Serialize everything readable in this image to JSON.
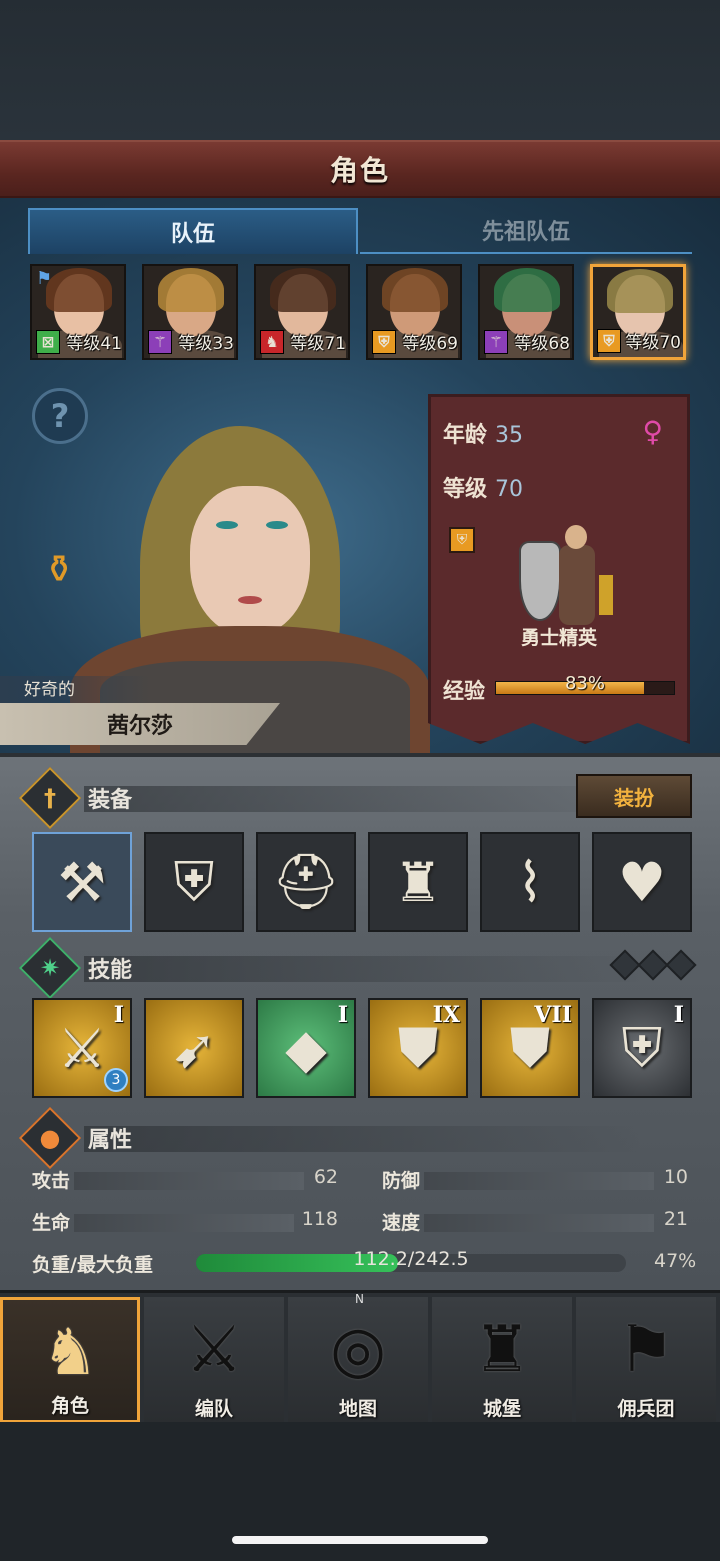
{
  "title": "角色",
  "tabs": {
    "team": "队伍",
    "ancestor_team": "先祖队伍"
  },
  "roster": [
    {
      "level_text": "等级41",
      "class_icon": "crossed-sword-icon",
      "badge_color": "#3fae4a",
      "badge_glyph": "⊠",
      "hair": "#6b3a1e",
      "skin": "#e8c0a4",
      "has_flag": true
    },
    {
      "level_text": "等级33",
      "class_icon": "staff-icon",
      "badge_color": "#8c3fb8",
      "badge_glyph": "⚚",
      "hair": "#b78a3a",
      "skin": "#d9a886",
      "has_flag": false
    },
    {
      "level_text": "等级71",
      "class_icon": "horse-icon",
      "badge_color": "#c8262a",
      "badge_glyph": "♞",
      "hair": "#4a2c1c",
      "skin": "#e2b89c",
      "has_flag": false
    },
    {
      "level_text": "等级69",
      "class_icon": "shield-icon",
      "badge_color": "#e89a22",
      "badge_glyph": "⛨",
      "hair": "#7a4a26",
      "skin": "#cf9a78",
      "has_flag": false
    },
    {
      "level_text": "等级68",
      "class_icon": "staff-icon",
      "badge_color": "#8c3fb8",
      "badge_glyph": "⚚",
      "hair": "#2f7a4a",
      "skin": "#c99078",
      "has_flag": false
    },
    {
      "level_text": "等级70",
      "class_icon": "shield-icon",
      "badge_color": "#e89a22",
      "badge_glyph": "⛨",
      "hair": "#9a8a4a",
      "skin": "#e6c4ae",
      "has_flag": false
    }
  ],
  "character": {
    "trait": "好奇的",
    "name": "茜尔莎",
    "age_label": "年龄",
    "age": "35",
    "level_label": "等级",
    "level": "70",
    "unit_class": "勇士精英",
    "exp_label": "经验",
    "exp_text": "83%",
    "exp_fraction": 0.83
  },
  "equipment": {
    "title": "装备",
    "dress_button": "装扮",
    "slots": [
      {
        "name": "warhammer-icon",
        "glyph": "⚒"
      },
      {
        "name": "shield-icon",
        "glyph": "⛨"
      },
      {
        "name": "helmet-icon",
        "glyph": "⛑"
      },
      {
        "name": "armor-icon",
        "glyph": "♜"
      },
      {
        "name": "boots-icon",
        "glyph": "⌇"
      },
      {
        "name": "heart-amulet-icon",
        "glyph": "♥"
      }
    ]
  },
  "skills": {
    "title": "技能",
    "list": [
      {
        "rank": "I",
        "style": "gold",
        "glyph": "⚔",
        "sub": "3"
      },
      {
        "rank": "",
        "style": "gold",
        "glyph": "➹",
        "sub": ""
      },
      {
        "rank": "I",
        "style": "green",
        "glyph": "◆",
        "sub": ""
      },
      {
        "rank": "IX",
        "style": "gold",
        "glyph": "⛊",
        "sub": ""
      },
      {
        "rank": "VII",
        "style": "gold",
        "glyph": "⛊",
        "sub": ""
      },
      {
        "rank": "I",
        "style": "dark",
        "glyph": "⛨",
        "sub": ""
      }
    ]
  },
  "attributes": {
    "title": "属性",
    "attack_label": "攻击",
    "attack": "62",
    "defense_label": "防御",
    "defense": "10",
    "hp_label": "生命",
    "hp": "118",
    "speed_label": "速度",
    "speed": "21",
    "load_label": "负重/最大负重",
    "load_text": "112.2/242.5",
    "load_percent": "47%",
    "load_fraction": 0.47
  },
  "nav": [
    {
      "label": "角色",
      "glyph": "♞",
      "active": true
    },
    {
      "label": "编队",
      "glyph": "⚔",
      "active": false
    },
    {
      "label": "地图",
      "glyph": "◎",
      "active": false
    },
    {
      "label": "城堡",
      "glyph": "♜",
      "active": false
    },
    {
      "label": "佣兵团",
      "glyph": "⚑",
      "active": false
    }
  ],
  "compass_letter": "N"
}
